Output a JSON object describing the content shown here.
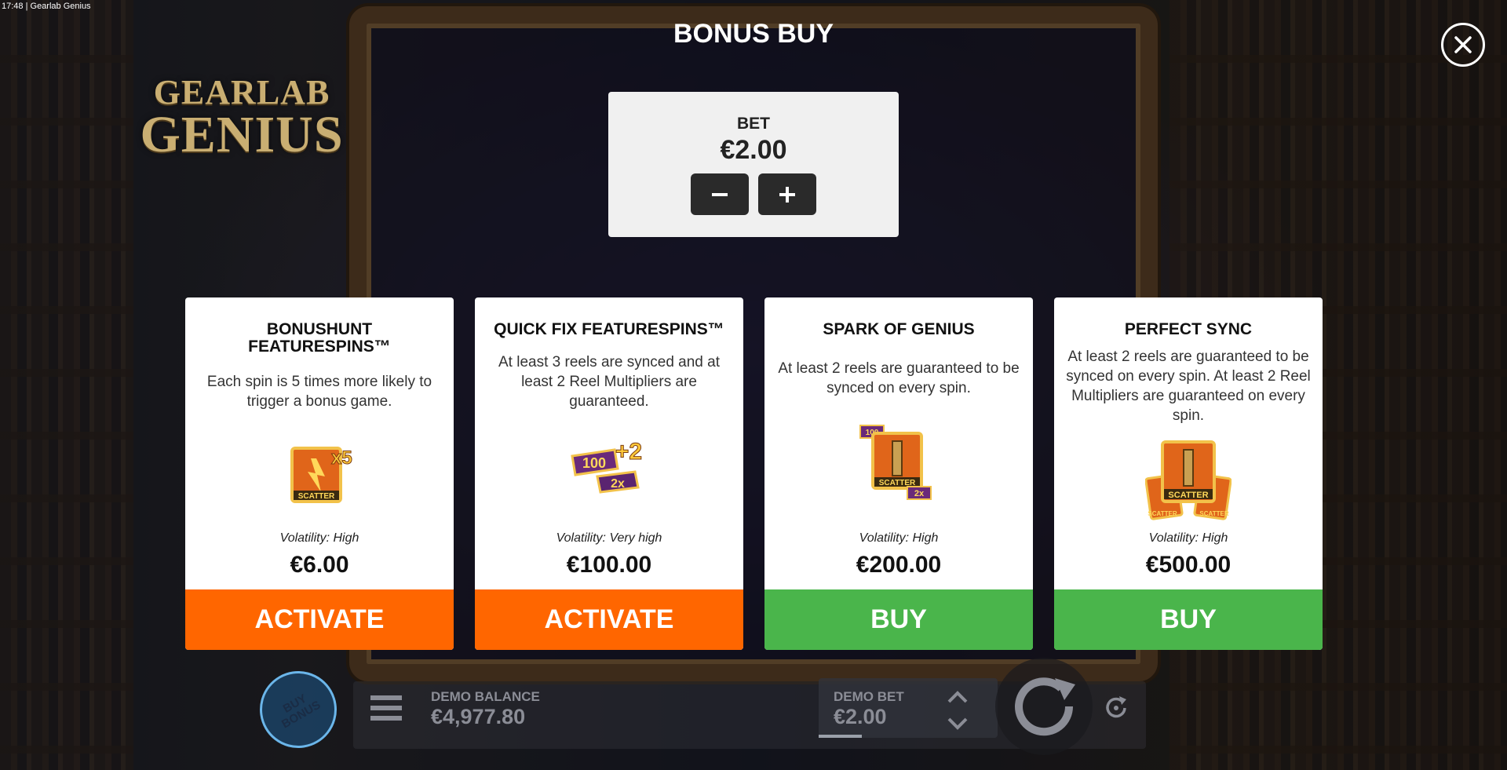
{
  "status": {
    "time": "17:48",
    "app_title": "Gearlab Genius"
  },
  "logo": {
    "line1": "GEARLAB",
    "line2": "GENIUS"
  },
  "header": {
    "title": "BONUS BUY",
    "close_icon": "close-icon"
  },
  "bet": {
    "label": "BET",
    "value": "€2.00",
    "minus_icon": "minus-icon",
    "plus_icon": "plus-icon"
  },
  "cards": [
    {
      "title": "BONUSHUNT FEATURESPINS™",
      "description": "Each spin is 5 times more likely to trigger a bonus game.",
      "icon": "scatter-x5-icon",
      "volatility": "Volatility: High",
      "price": "€6.00",
      "button": "ACTIVATE",
      "button_color": "#ff6600"
    },
    {
      "title": "QUICK FIX FEATURESPINS™",
      "description": "At least 3 reels are synced and at least 2 Reel Multipliers are guaranteed.",
      "icon": "multiplier-100-2-icon",
      "volatility": "Volatility: Very high",
      "price": "€100.00",
      "button": "ACTIVATE",
      "button_color": "#ff6600"
    },
    {
      "title": "SPARK OF GENIUS",
      "description": "At least 2 reels are guaranteed to be synced on every spin.",
      "icon": "scatter-tower-icon",
      "volatility": "Volatility: High",
      "price": "€200.00",
      "button": "BUY",
      "button_color": "#4ab54b"
    },
    {
      "title": "PERFECT SYNC",
      "description": "At least 2 reels are guaranteed to be synced on every spin. At least 2 Reel Multipliers are guaranteed on every spin.",
      "icon": "triple-scatter-icon",
      "volatility": "Volatility: High",
      "price": "€500.00",
      "button": "BUY",
      "button_color": "#4ab54b"
    }
  ],
  "bottom_bar": {
    "buy_bonus_line1": "BUY",
    "buy_bonus_line2": "BONUS",
    "demo_balance_label": "DEMO BALANCE",
    "demo_balance_value": "€4,977.80",
    "demo_bet_label": "DEMO BET",
    "demo_bet_value": "€2.00"
  }
}
